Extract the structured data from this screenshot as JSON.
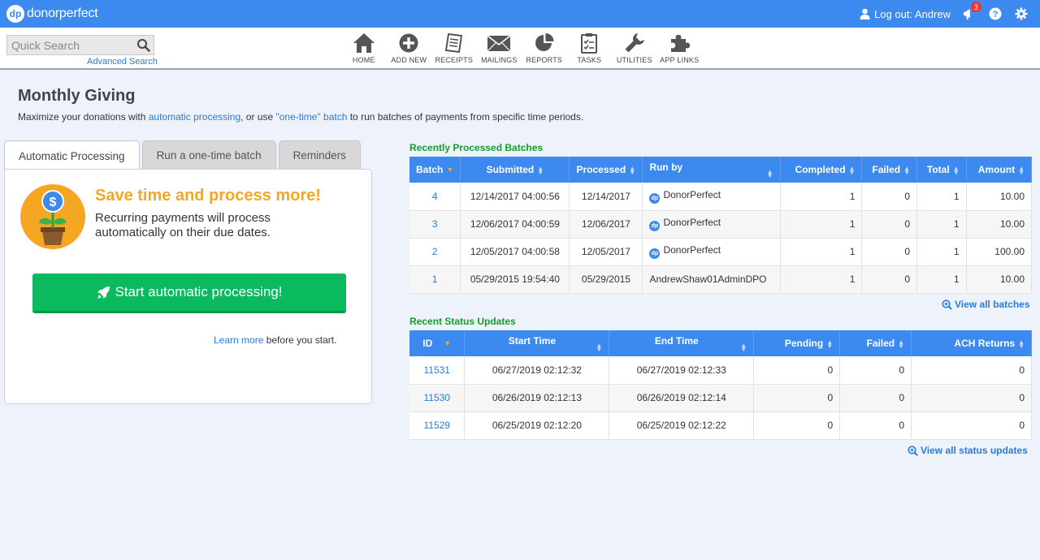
{
  "app": {
    "logo_badge": "dp",
    "logo_text": "donorperfect"
  },
  "topbar": {
    "logout_label": "Log out: Andrew",
    "notification_count": "3"
  },
  "search": {
    "placeholder": "Quick Search",
    "advanced_label": "Advanced Search"
  },
  "nav": [
    {
      "label": "HOME",
      "icon": "home-icon"
    },
    {
      "label": "ADD NEW",
      "icon": "plus-circle-icon"
    },
    {
      "label": "RECEIPTS",
      "icon": "receipt-icon"
    },
    {
      "label": "MAILINGS",
      "icon": "envelope-icon"
    },
    {
      "label": "REPORTS",
      "icon": "pie-chart-icon"
    },
    {
      "label": "TASKS",
      "icon": "clipboard-icon"
    },
    {
      "label": "UTILITIES",
      "icon": "wrench-icon"
    },
    {
      "label": "APP LINKS",
      "icon": "puzzle-icon"
    }
  ],
  "page": {
    "title": "Monthly Giving",
    "subtitle_1": "Maximize your donations with ",
    "subtitle_link_1": "automatic processing",
    "subtitle_2": ", or use ",
    "subtitle_link_2": "\"one-time\" batch",
    "subtitle_3": " to run batches of payments from specific time periods."
  },
  "tabs": [
    {
      "label": "Automatic Processing",
      "active": true
    },
    {
      "label": "Run a one-time batch",
      "active": false
    },
    {
      "label": "Reminders",
      "active": false
    }
  ],
  "promo": {
    "heading": "Save time and process more!",
    "body": "Recurring payments will process automatically on their due dates.",
    "button": "Start automatic processing!",
    "learn_link": "Learn more",
    "learn_rest": " before you start."
  },
  "colors": {
    "brand": "#3c8af0",
    "accent": "#f5a623",
    "success": "#0bba5f",
    "section_title": "#149c2c"
  },
  "batches": {
    "title": "Recently Processed Batches",
    "headers": [
      "Batch",
      "Submitted",
      "Processed",
      "Run by",
      "Completed",
      "Failed",
      "Total",
      "Amount"
    ],
    "rows": [
      {
        "batch": "4",
        "submitted": "12/14/2017 04:00:56",
        "processed": "12/14/2017",
        "run_by": "DonorPerfect",
        "dp": true,
        "completed": "1",
        "failed": "0",
        "total": "1",
        "amount": "10.00"
      },
      {
        "batch": "3",
        "submitted": "12/06/2017 04:00:59",
        "processed": "12/06/2017",
        "run_by": "DonorPerfect",
        "dp": true,
        "completed": "1",
        "failed": "0",
        "total": "1",
        "amount": "10.00"
      },
      {
        "batch": "2",
        "submitted": "12/05/2017 04:00:58",
        "processed": "12/05/2017",
        "run_by": "DonorPerfect",
        "dp": true,
        "completed": "1",
        "failed": "0",
        "total": "1",
        "amount": "100.00"
      },
      {
        "batch": "1",
        "submitted": "05/29/2015 19:54:40",
        "processed": "05/29/2015",
        "run_by": "AndrewShaw01AdminDPO",
        "dp": false,
        "completed": "1",
        "failed": "0",
        "total": "1",
        "amount": "10.00"
      }
    ],
    "view_all": "View all batches"
  },
  "status": {
    "title": "Recent Status Updates",
    "headers": [
      "ID",
      "Start Time",
      "End Time",
      "Pending",
      "Failed",
      "ACH Returns"
    ],
    "rows": [
      {
        "id": "11531",
        "start": "06/27/2019 02:12:32",
        "end": "06/27/2019 02:12:33",
        "pending": "0",
        "failed": "0",
        "ach": "0"
      },
      {
        "id": "11530",
        "start": "06/26/2019 02:12:13",
        "end": "06/26/2019 02:12:14",
        "pending": "0",
        "failed": "0",
        "ach": "0"
      },
      {
        "id": "11529",
        "start": "06/25/2019 02:12:20",
        "end": "06/25/2019 02:12:22",
        "pending": "0",
        "failed": "0",
        "ach": "0"
      }
    ],
    "view_all": "View all status updates"
  }
}
